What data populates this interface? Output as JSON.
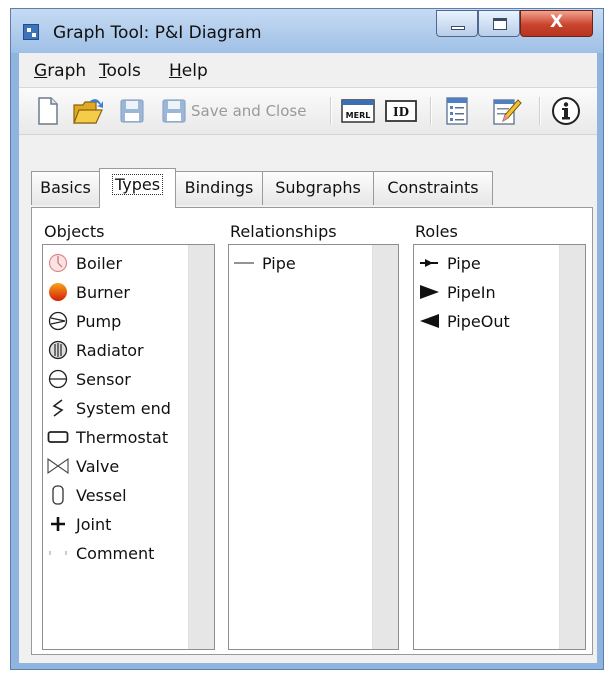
{
  "window": {
    "title": "Graph Tool: P&I Diagram",
    "close_glyph": "X"
  },
  "menubar": [
    {
      "key": "G",
      "rest": "raph"
    },
    {
      "key": "T",
      "rest": "ools"
    },
    {
      "key": "H",
      "rest": "elp"
    }
  ],
  "toolbar": {
    "save_and_close_label": "Save and Close",
    "merl_label": "MERL",
    "id_label": "ID"
  },
  "tabs": [
    "Basics",
    "Types",
    "Bindings",
    "Subgraphs",
    "Constraints"
  ],
  "active_tab": "Types",
  "columns": {
    "objects_label": "Objects",
    "relationships_label": "Relationships",
    "roles_label": "Roles"
  },
  "objects": [
    {
      "label": "Boiler",
      "icon": "boiler-icon"
    },
    {
      "label": "Burner",
      "icon": "burner-icon"
    },
    {
      "label": "Pump",
      "icon": "pump-icon"
    },
    {
      "label": "Radiator",
      "icon": "radiator-icon"
    },
    {
      "label": "Sensor",
      "icon": "sensor-icon"
    },
    {
      "label": "System end",
      "icon": "system-end-icon"
    },
    {
      "label": "Thermostat",
      "icon": "thermostat-icon"
    },
    {
      "label": "Valve",
      "icon": "valve-icon"
    },
    {
      "label": "Vessel",
      "icon": "vessel-icon"
    },
    {
      "label": "Joint",
      "icon": "joint-icon"
    },
    {
      "label": "Comment",
      "icon": "comment-icon"
    }
  ],
  "relationships": [
    {
      "label": "Pipe",
      "icon": "line-icon"
    }
  ],
  "roles": [
    {
      "label": "Pipe",
      "icon": "pipe-role-icon"
    },
    {
      "label": "PipeIn",
      "icon": "pipe-in-arrow-icon"
    },
    {
      "label": "PipeOut",
      "icon": "pipe-out-arrow-icon"
    }
  ],
  "colors": {
    "title_bar": "#9fc0e6",
    "close_button": "#c9442d",
    "burner": "#e23a10"
  }
}
